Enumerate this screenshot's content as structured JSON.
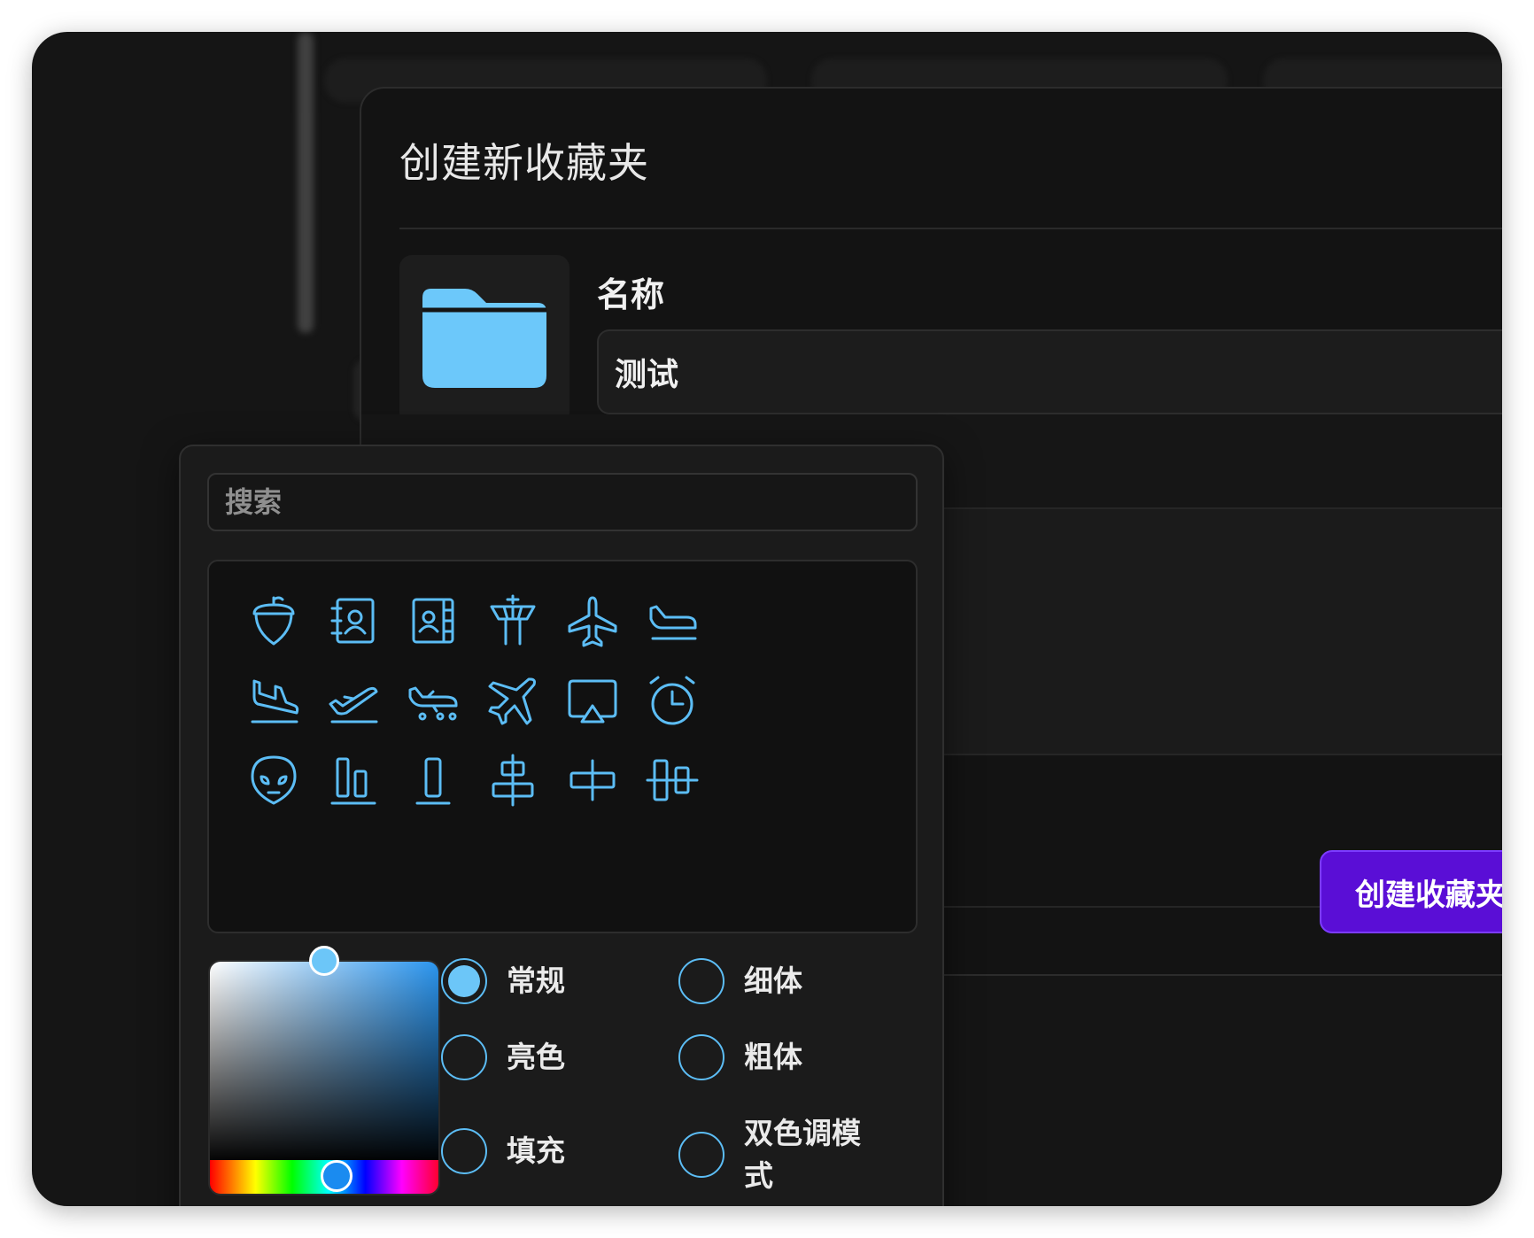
{
  "dialog": {
    "title": "创建新收藏夹",
    "name_label": "名称",
    "name_value": "测试",
    "create_button": "创建收藏夹",
    "folder_color": "#6cc8fa"
  },
  "picker": {
    "search_placeholder": "搜索",
    "icon_color": "#5cbdf5",
    "icons": [
      "acorn-icon",
      "address-book-icon",
      "address-book-tabs-icon",
      "air-traffic-control-icon",
      "airplane-icon",
      "airplane-in-flight-icon",
      "airplane-landing-icon",
      "airplane-takeoff-icon",
      "airplane-taxiing-icon",
      "airplane-tilt-icon",
      "airplay-icon",
      "alarm-icon",
      "alien-icon",
      "align-bottom-icon",
      "align-bottom-simple-icon",
      "align-center-horizontal-icon",
      "align-center-horizontal-simple-icon",
      "align-center-vertical-icon"
    ],
    "color": {
      "selected_hue": "#1a8bf0",
      "selected_color": "#6cc6f8"
    },
    "weights": [
      {
        "label": "常规",
        "selected": true
      },
      {
        "label": "细体",
        "selected": false
      },
      {
        "label": "亮色",
        "selected": false
      },
      {
        "label": "粗体",
        "selected": false
      },
      {
        "label": "填充",
        "selected": false
      },
      {
        "label": "双色调模式",
        "selected": false
      }
    ]
  }
}
